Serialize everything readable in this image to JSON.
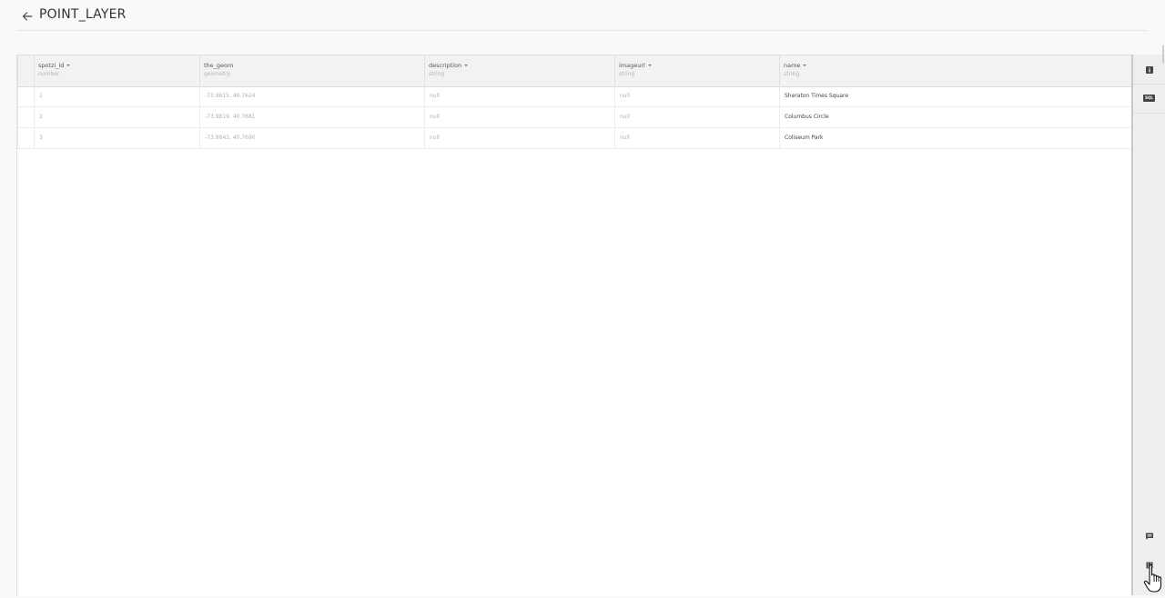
{
  "header": {
    "title": "POINT_LAYER",
    "back_icon": "arrow-left-icon"
  },
  "table": {
    "columns": [
      {
        "name": "spotzi_id",
        "type": "number",
        "sortable": true
      },
      {
        "name": "the_geom",
        "type": "geometry",
        "sortable": false
      },
      {
        "name": "description",
        "type": "string",
        "sortable": true
      },
      {
        "name": "imageurl",
        "type": "string",
        "sortable": true
      },
      {
        "name": "name",
        "type": "string",
        "sortable": true
      }
    ],
    "rows": [
      {
        "spotzi_id": "1",
        "the_geom": "-73.9815, 40.7624",
        "description": "null",
        "imageurl": "null",
        "name": "Sheraton Times Square"
      },
      {
        "spotzi_id": "2",
        "the_geom": "-73.9819, 40.7681",
        "description": "null",
        "imageurl": "null",
        "name": "Columbus Circle"
      },
      {
        "spotzi_id": "3",
        "the_geom": "-73.9843, 40.7690",
        "description": "null",
        "imageurl": "null",
        "name": "Coliseum Park"
      }
    ]
  },
  "rail": {
    "icons": [
      "info-icon",
      "sql-icon",
      "comment-icon",
      "columns-icon"
    ],
    "sql_label": "SQL"
  },
  "colors": {
    "header_bg": "#f2f2f2",
    "rail_bg": "#efefef"
  }
}
